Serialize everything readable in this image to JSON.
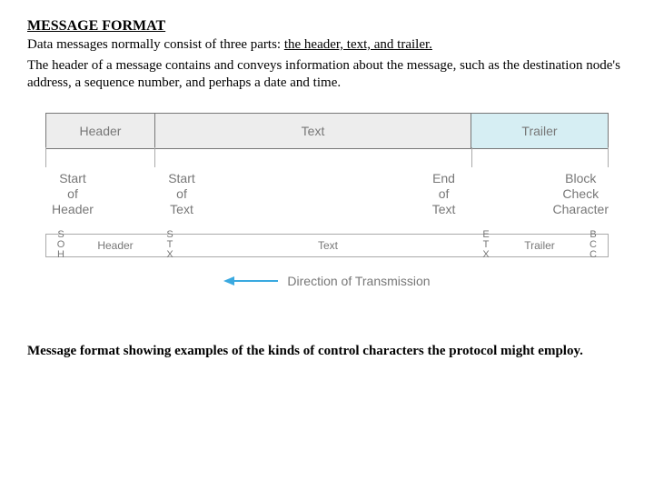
{
  "title": "MESSAGE FORMAT",
  "para1_prefix": "Data messages normally consist of three parts: ",
  "para1_underlined": "the header, text, and trailer.",
  "para2": "The header of a message contains and conveys information about the message, such as the destination node's address, a sequence number, and perhaps a date and time.",
  "segments": {
    "header": "Header",
    "text": "Text",
    "trailer": "Trailer"
  },
  "labels": {
    "soh": "Start\nof\nHeader",
    "stx": "Start\nof\nText",
    "etx": "End\nof\nText",
    "bcc": "Block\nCheck\nCharacter"
  },
  "breakdown": {
    "soh": "S\nO\nH",
    "header": "Header",
    "stx": "S\nT\nX",
    "text": "Text",
    "etx": "E\nT\nX",
    "trailer": "Trailer",
    "bcc": "B\nC\nC"
  },
  "direction_label": "Direction of Transmission",
  "caption": "Message format showing examples of the kinds of control characters the protocol might employ."
}
